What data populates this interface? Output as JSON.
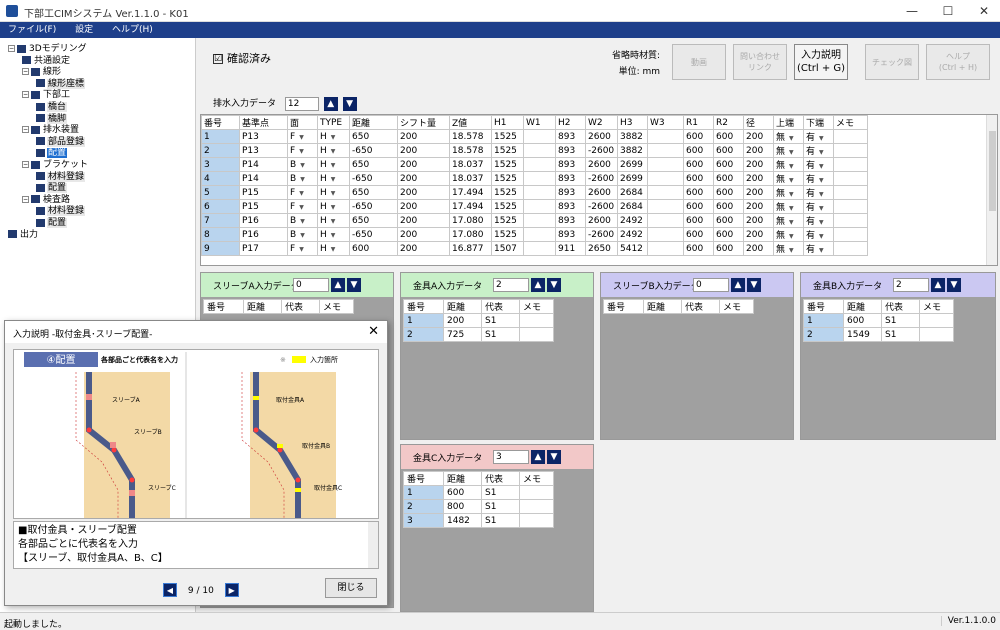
{
  "window": {
    "title": "下部工CIMシステム Ver.1.1.0 - K01",
    "min": "—",
    "max": "☐",
    "close": "✕"
  },
  "menu": [
    "ファイル(F)",
    "設定",
    "ヘルプ(H)"
  ],
  "tree": [
    {
      "label": "3Dモデリング",
      "level": 0,
      "exp": "−"
    },
    {
      "label": "共通設定",
      "level": 1
    },
    {
      "label": "線形",
      "level": 1,
      "exp": "−"
    },
    {
      "label": "線形座標",
      "level": 2
    },
    {
      "label": "下部工",
      "level": 1,
      "exp": "−"
    },
    {
      "label": "橋台",
      "level": 2
    },
    {
      "label": "橋脚",
      "level": 2
    },
    {
      "label": "排水装置",
      "level": 1,
      "exp": "−"
    },
    {
      "label": "部品登録",
      "level": 2
    },
    {
      "label": "配置",
      "level": 2,
      "selected": true
    },
    {
      "label": "ブラケット",
      "level": 1,
      "exp": "−"
    },
    {
      "label": "材料登録",
      "level": 2
    },
    {
      "label": "配置",
      "level": 2
    },
    {
      "label": "検査路",
      "level": 1,
      "exp": "−"
    },
    {
      "label": "材料登録",
      "level": 2
    },
    {
      "label": "配置",
      "level": 2
    },
    {
      "label": "出力",
      "level": 0
    }
  ],
  "confirmed": {
    "label": "確認済み",
    "check": "☑"
  },
  "units": {
    "material": "省略時材質:",
    "unit": "単位: mm"
  },
  "toolbar": [
    {
      "label": "動画",
      "active": false
    },
    {
      "label": "問い合わせ\nリンク",
      "active": false
    },
    {
      "label": "入力説明\n(Ctrl + G)",
      "active": true
    },
    {
      "label": "チェック図",
      "active": false
    },
    {
      "label": "ヘルプ\n(Ctrl + H)",
      "active": false
    }
  ],
  "drain": {
    "label": "排水入力データ",
    "value": "12"
  },
  "arrows": {
    "up": "▲",
    "down": "▼",
    "left": "◀",
    "right": "▶"
  },
  "main_table": {
    "headers": [
      "番号",
      "基準点",
      "面",
      "TYPE",
      "距離",
      "シフト量",
      "Z値",
      "H1",
      "W1",
      "H2",
      "W2",
      "H3",
      "W3",
      "R1",
      "R2",
      "径",
      "上端",
      "下端",
      "メモ"
    ],
    "rows": [
      [
        "1",
        "P13",
        "F",
        "H",
        "650",
        "200",
        "18.578",
        "1525",
        "",
        "893",
        "2600",
        "3882",
        "",
        "600",
        "600",
        "200",
        "無",
        "有",
        ""
      ],
      [
        "2",
        "P13",
        "F",
        "H",
        "-650",
        "200",
        "18.578",
        "1525",
        "",
        "893",
        "-2600",
        "3882",
        "",
        "600",
        "600",
        "200",
        "無",
        "有",
        ""
      ],
      [
        "3",
        "P14",
        "B",
        "H",
        "650",
        "200",
        "18.037",
        "1525",
        "",
        "893",
        "2600",
        "2699",
        "",
        "600",
        "600",
        "200",
        "無",
        "有",
        ""
      ],
      [
        "4",
        "P14",
        "B",
        "H",
        "-650",
        "200",
        "18.037",
        "1525",
        "",
        "893",
        "-2600",
        "2699",
        "",
        "600",
        "600",
        "200",
        "無",
        "有",
        ""
      ],
      [
        "5",
        "P15",
        "F",
        "H",
        "650",
        "200",
        "17.494",
        "1525",
        "",
        "893",
        "2600",
        "2684",
        "",
        "600",
        "600",
        "200",
        "無",
        "有",
        ""
      ],
      [
        "6",
        "P15",
        "F",
        "H",
        "-650",
        "200",
        "17.494",
        "1525",
        "",
        "893",
        "-2600",
        "2684",
        "",
        "600",
        "600",
        "200",
        "無",
        "有",
        ""
      ],
      [
        "7",
        "P16",
        "B",
        "H",
        "650",
        "200",
        "17.080",
        "1525",
        "",
        "893",
        "2600",
        "2492",
        "",
        "600",
        "600",
        "200",
        "無",
        "有",
        ""
      ],
      [
        "8",
        "P16",
        "B",
        "H",
        "-650",
        "200",
        "17.080",
        "1525",
        "",
        "893",
        "-2600",
        "2492",
        "",
        "600",
        "600",
        "200",
        "無",
        "有",
        ""
      ],
      [
        "9",
        "P17",
        "F",
        "H",
        "600",
        "200",
        "16.877",
        "1507",
        "",
        "911",
        "2650",
        "5412",
        "",
        "600",
        "600",
        "200",
        "無",
        "有",
        ""
      ]
    ]
  },
  "sub_headers": [
    "番号",
    "距離",
    "代表",
    "メモ"
  ],
  "panels": {
    "sleeveA": {
      "label": "スリーブA入力データ",
      "value": "0",
      "rows": []
    },
    "fittingA": {
      "label": "金具A入力データ",
      "value": "2",
      "rows": [
        [
          "1",
          "200",
          "S1",
          ""
        ],
        [
          "2",
          "725",
          "S1",
          ""
        ]
      ]
    },
    "sleeveB": {
      "label": "スリーブB入力データ",
      "value": "0",
      "rows": []
    },
    "fittingB": {
      "label": "金具B入力データ",
      "value": "2",
      "rows": [
        [
          "1",
          "600",
          "S1",
          ""
        ],
        [
          "2",
          "1549",
          "S1",
          ""
        ]
      ]
    },
    "fittingC": {
      "label": "金具C入力データ",
      "value": "3",
      "rows": [
        [
          "1",
          "600",
          "S1",
          ""
        ],
        [
          "2",
          "800",
          "S1",
          ""
        ],
        [
          "3",
          "1482",
          "S1",
          ""
        ]
      ]
    }
  },
  "dialog": {
    "title": "入力説明 -取付金具･スリーブ配置-",
    "close": "✕",
    "step": "④配置",
    "step_desc": "各部品ごと代表名を入力",
    "legend": "入力箇所",
    "legend_mark": "※",
    "labels_left": [
      "スリーブA",
      "スリーブB",
      "スリーブC"
    ],
    "labels_right": [
      "取付金具A",
      "取付金具B",
      "取付金具C"
    ],
    "desc_lines": [
      "■取付金具・スリーブ配置",
      "各部品ごとに代表名を入力",
      "【スリーブ、取付金具A、B、C】"
    ],
    "page": "9 / 10",
    "close_button": "閉じる",
    "colors": {
      "pipe": "#4a5a8a",
      "post": "#f3d9a6",
      "marker": "#ff3b3b",
      "highlight": "#ffff00"
    }
  },
  "status": {
    "left": "起動しました。",
    "right": "Ver.1.1.0.0"
  }
}
